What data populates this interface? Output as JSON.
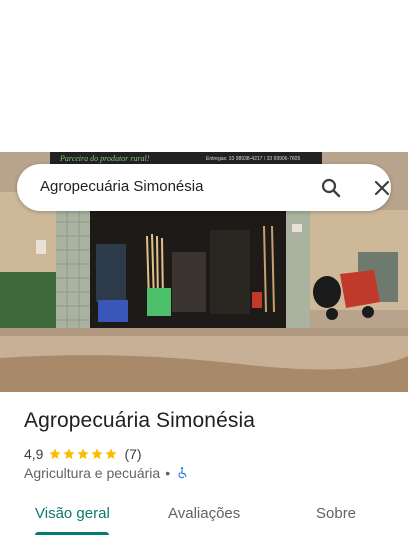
{
  "search": {
    "query": "Agropecuária Simonésia"
  },
  "place": {
    "name": "Agropecuária Simonésia",
    "rating": "4,9",
    "stars": 5,
    "review_count": "(7)",
    "category": "Agricultura e pecuária",
    "separator": "•"
  },
  "photo": {
    "sign_slogan": "Parceira do produtor rural!",
    "sign_contact": "Entregas: 33 98938-4217 / 33 99906-7605"
  },
  "tabs": [
    {
      "label": "Visão geral",
      "active": true
    },
    {
      "label": "Avaliações",
      "active": false
    },
    {
      "label": "Sobre",
      "active": false
    }
  ],
  "icons": {
    "search": "search-icon",
    "close": "close-icon",
    "star": "star-icon",
    "accessibility": "wheelchair-icon"
  },
  "colors": {
    "accent": "#0b7a6e",
    "star": "#fbbc04",
    "accessibility": "#1a73e8"
  }
}
